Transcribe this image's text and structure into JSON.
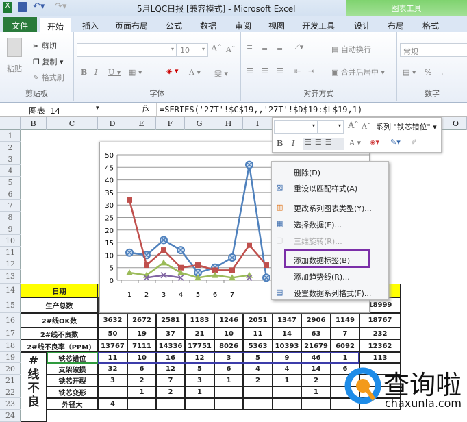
{
  "window": {
    "title": "5月LQC日报  [兼容模式]  -  Microsoft Excel",
    "context_tab_group": "图表工具"
  },
  "tabs": [
    "文件",
    "开始",
    "插入",
    "页面布局",
    "公式",
    "数据",
    "审阅",
    "视图",
    "开发工具",
    "设计",
    "布局",
    "格式"
  ],
  "ribbon": {
    "clipboard": {
      "paste": "粘贴",
      "cut": "剪切",
      "copy": "复制",
      "format_painter": "格式刷",
      "label": "剪贴板"
    },
    "font": {
      "size": "10",
      "label": "字体"
    },
    "alignment": {
      "wrap": "自动换行",
      "merge": "合并后居中",
      "label": "对齐方式"
    },
    "number": {
      "format": "常规",
      "label": "数字",
      "percent": "%",
      "comma": ","
    }
  },
  "formula_bar": {
    "name_box": "图表 14",
    "fx": "fx",
    "formula": "=SERIES('27T'!$C$19,,'27T'!$D$19:$L$19,1)"
  },
  "columns": [
    "B",
    "C",
    "D",
    "E",
    "F",
    "G",
    "H",
    "I",
    "O"
  ],
  "rows": [
    "1",
    "2",
    "3",
    "4",
    "5",
    "6",
    "7",
    "8",
    "9",
    "10",
    "11",
    "12",
    "13",
    "14",
    "15",
    "16",
    "17",
    "18",
    "19",
    "20",
    "21",
    "22",
    "23",
    "24"
  ],
  "table": {
    "header": "日期",
    "rows": [
      {
        "label": "生产总数",
        "values": [
          "",
          "",
          "",
          "",
          "",
          "",
          "",
          "",
          ""
        ],
        "total": "18999"
      },
      {
        "label": "2#线OK数",
        "values": [
          "3632",
          "2672",
          "2581",
          "1183",
          "1246",
          "2051",
          "1347",
          "2906",
          "1149"
        ],
        "total": "18767"
      },
      {
        "label": "2#线不良数",
        "values": [
          "50",
          "19",
          "37",
          "21",
          "10",
          "11",
          "14",
          "63",
          "7"
        ],
        "total": "232"
      },
      {
        "label": "2#线不良率（PPM)",
        "values": [
          "13767",
          "7111",
          "14336",
          "17751",
          "8026",
          "5363",
          "10393",
          "21679",
          "6092"
        ],
        "total": "12362"
      }
    ],
    "defect_group": "#\n线\n不\n良",
    "defects": [
      {
        "label": "铁芯错位",
        "values": [
          "11",
          "10",
          "16",
          "12",
          "3",
          "5",
          "9",
          "46",
          "1"
        ],
        "total": "113"
      },
      {
        "label": "支架破损",
        "values": [
          "32",
          "6",
          "12",
          "5",
          "6",
          "4",
          "4",
          "14",
          "6"
        ],
        "total": ""
      },
      {
        "label": "铁芯开裂",
        "values": [
          "3",
          "2",
          "7",
          "3",
          "1",
          "2",
          "1",
          "2",
          ""
        ],
        "total": ""
      },
      {
        "label": "铁芯变形",
        "values": [
          "",
          "1",
          "2",
          "1",
          "",
          "",
          "",
          "1",
          ""
        ],
        "total": ""
      },
      {
        "label": "外径大",
        "values": [
          "4",
          "",
          "",
          "",
          "",
          "",
          "",
          "",
          ""
        ],
        "total": ""
      }
    ]
  },
  "mini_toolbar": {
    "series_select": "系列 \"铁芯错位\"",
    "bold": "B",
    "italic": "I",
    "font_a": "A"
  },
  "context_menu": [
    {
      "label": "删除(D)",
      "disabled": false
    },
    {
      "label": "重设以匹配样式(A)",
      "disabled": false
    },
    {
      "label": "更改系列图表类型(Y)...",
      "disabled": false
    },
    {
      "label": "选择数据(E)...",
      "disabled": false
    },
    {
      "label": "三维旋转(R)...",
      "disabled": true
    },
    {
      "label": "添加数据标签(B)",
      "disabled": false,
      "highlighted": true
    },
    {
      "label": "添加趋势线(R)...",
      "disabled": false
    },
    {
      "label": "设置数据系列格式(F)...",
      "disabled": false
    }
  ],
  "watermark": {
    "brand": "查询啦",
    "url": "chaxunla.com"
  },
  "chart_data": {
    "type": "line",
    "x": [
      1,
      2,
      3,
      4,
      5,
      6,
      7,
      8,
      9
    ],
    "x_tick_labels": [
      "1",
      "2",
      "3",
      "4",
      "5",
      "6",
      "7"
    ],
    "ylim": [
      0,
      50
    ],
    "y_ticks": [
      "0",
      "5",
      "10",
      "15",
      "20",
      "25",
      "30",
      "35",
      "40",
      "45",
      "50"
    ],
    "grid": true,
    "series": [
      {
        "name": "铁芯错位",
        "color": "#4f81bd",
        "marker": "x-circle",
        "values": [
          11,
          10,
          16,
          12,
          3,
          5,
          9,
          46,
          1
        ]
      },
      {
        "name": "支架破损",
        "color": "#c0504d",
        "marker": "square",
        "values": [
          32,
          6,
          12,
          5,
          6,
          4,
          4,
          14,
          6
        ]
      },
      {
        "name": "铁芯开裂",
        "color": "#9bbb59",
        "marker": "triangle",
        "values": [
          3,
          2,
          7,
          3,
          1,
          2,
          1,
          2,
          null
        ]
      },
      {
        "name": "铁芯变形",
        "color": "#8064a2",
        "marker": "x",
        "values": [
          null,
          1,
          2,
          1,
          null,
          null,
          null,
          1,
          null
        ]
      }
    ]
  }
}
